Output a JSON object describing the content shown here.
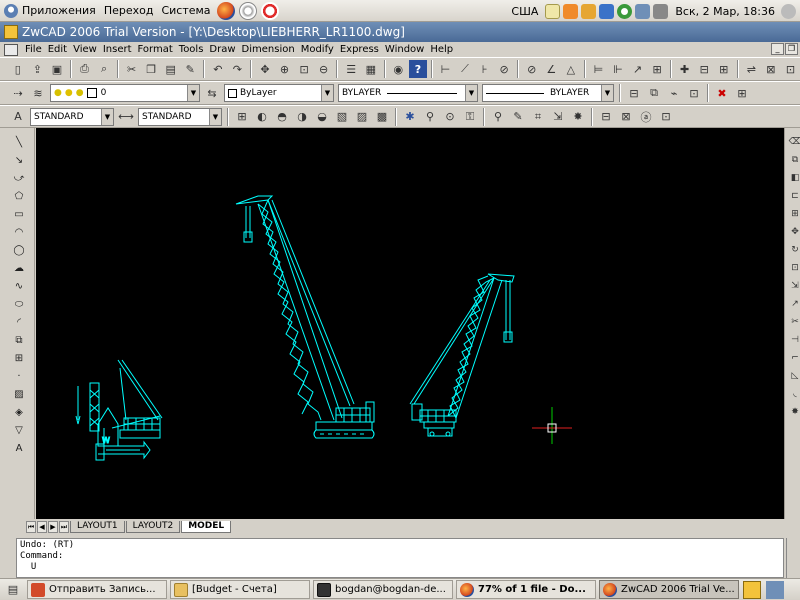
{
  "top_panel": {
    "apps_menu": "Приложения",
    "places_menu": "Переход",
    "system_menu": "Система",
    "keyboard_layout": "США",
    "datetime": "Вск,  2 Мар, 18:36"
  },
  "window": {
    "title": "ZwCAD 2006 Trial Version - [Y:\\Desktop\\LIEBHERR_LR1100.dwg]"
  },
  "menu": {
    "items": [
      "File",
      "Edit",
      "View",
      "Insert",
      "Format",
      "Tools",
      "Draw",
      "Dimension",
      "Modify",
      "Express",
      "Window",
      "Help"
    ]
  },
  "layer_toolbar": {
    "layer_value": "0",
    "color_value": "ByLayer",
    "linetype_value": "BYLAYER",
    "lineweight_value": "BYLAYER"
  },
  "style_toolbar": {
    "text_style": "STANDARD",
    "dim_style": "STANDARD"
  },
  "layout_tabs": [
    "LAYOUT1",
    "LAYOUT2",
    "MODEL"
  ],
  "active_tab": "MODEL",
  "command_line": {
    "lines": [
      "Undo: (RT)",
      "Command:",
      "  U"
    ]
  },
  "taskbar": {
    "tasks": [
      {
        "label": "Отправить Запись...",
        "active": false
      },
      {
        "label": "[Budget - Счета]",
        "active": false
      },
      {
        "label": "bogdan@bogdan-de...",
        "active": false
      },
      {
        "label": "77% of 1 file - Do...",
        "active": false
      },
      {
        "label": "ZwCAD 2006 Trial Ve...",
        "active": true
      }
    ]
  },
  "colors": {
    "drawing_background": "#000000",
    "drawing_lines": "#00ffff",
    "cursor_green": "#00cc00",
    "cursor_red": "#e02020",
    "title_bar": "#4a6a96"
  }
}
